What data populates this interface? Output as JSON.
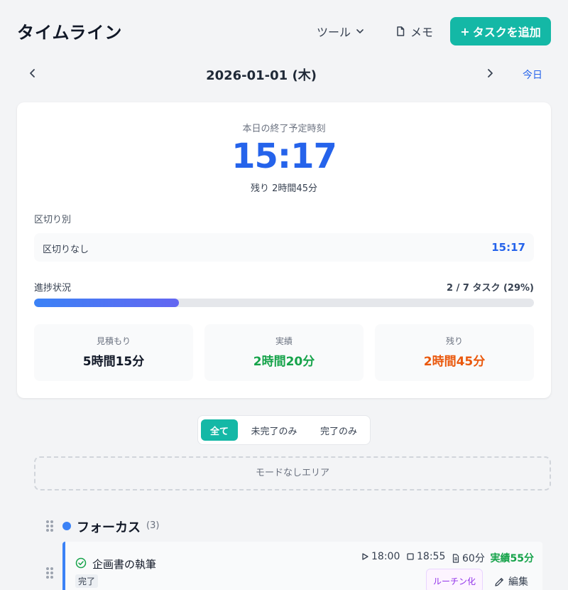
{
  "header": {
    "title": "タイムライン",
    "tools_label": "ツール",
    "memo_label": "メモ",
    "add_task_label": "タスクを追加"
  },
  "date_nav": {
    "date": "2026-01-01 (木)",
    "today_label": "今日"
  },
  "summary": {
    "end_label": "本日の終了予定時刻",
    "end_time": "15:17",
    "remaining_text": "残り 2時間45分",
    "segment_section_label": "区切り別",
    "segments": [
      {
        "name": "区切りなし",
        "time": "15:17"
      }
    ],
    "progress_label": "進捗状況",
    "progress_text": "2 / 7 タスク (29%)",
    "progress_percent": 29,
    "stats": [
      {
        "label": "見積もり",
        "value": "5時間15分",
        "color": "#111827"
      },
      {
        "label": "実績",
        "value": "2時間20分",
        "color": "#16a34a"
      },
      {
        "label": "残り",
        "value": "2時間45分",
        "color": "#ea580c"
      }
    ]
  },
  "filter": {
    "options": [
      "全て",
      "未完了のみ",
      "完了のみ"
    ],
    "selected": "全て"
  },
  "no_mode_area_label": "モードなしエリア",
  "group": {
    "name": "フォーカス",
    "count": "(3)",
    "color": "#3b82f6"
  },
  "task": {
    "title": "企画書の執筆",
    "status": "完了",
    "start": "18:00",
    "end": "18:55",
    "estimate": "60分",
    "actual": "実績55分",
    "routine_label": "ルーチン化",
    "edit_label": "編集"
  },
  "colors": {
    "accent": "#14b8a6",
    "primary": "#2563eb"
  }
}
